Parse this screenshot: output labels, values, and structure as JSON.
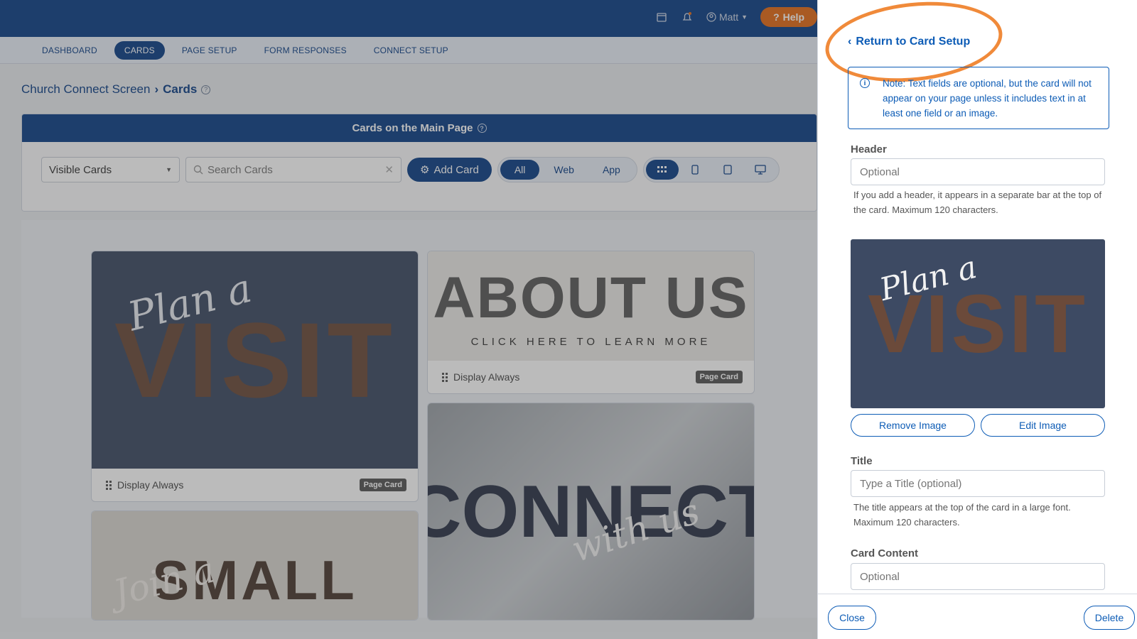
{
  "topbar": {
    "user_name": "Matt",
    "help_label": "Help"
  },
  "nav": {
    "items": [
      "DASHBOARD",
      "CARDS",
      "PAGE SETUP",
      "FORM RESPONSES",
      "CONNECT SETUP"
    ],
    "active": "CARDS"
  },
  "breadcrumb": {
    "parent": "Church Connect Screen",
    "current": "Cards"
  },
  "panel": {
    "title": "Cards on the Main Page",
    "filter_select": "Visible Cards",
    "search_placeholder": "Search Cards",
    "add_card_label": "Add Card",
    "platform_tabs": [
      "All",
      "Web",
      "App"
    ],
    "active_platform": "All"
  },
  "cards": [
    {
      "image_script": "Plan a",
      "image_text": "VISIT",
      "display": "Display Always",
      "badge": "Page Card"
    },
    {
      "image_text": "ABOUT US",
      "image_sub": "CLICK HERE TO LEARN MORE",
      "display": "Display Always",
      "badge": "Page Card"
    },
    {
      "image_script": "with us",
      "image_text": "CONNECT"
    },
    {
      "image_script": "Join a",
      "image_text": "SMALL"
    }
  ],
  "drawer": {
    "return_label": "Return to Card Setup",
    "note": "Note: Text fields are optional, but the card will not appear on your page unless it includes text in at least one field or an image.",
    "header_label": "Header",
    "header_placeholder": "Optional",
    "header_help": "If you add a header, it appears in a separate bar at the top of the card. Maximum 120 characters.",
    "preview_script": "Plan a",
    "preview_text": "VISIT",
    "remove_image_label": "Remove Image",
    "edit_image_label": "Edit Image",
    "title_label": "Title",
    "title_placeholder": "Type a Title (optional)",
    "title_help": "The title appears at the top of the card in a large font. Maximum 120 characters.",
    "content_label": "Card Content",
    "content_placeholder": "Optional",
    "close_label": "Close",
    "delete_label": "Delete"
  },
  "colors": {
    "primary": "#0d3f86",
    "link": "#0d5cb6",
    "help_orange": "#e36a16",
    "highlight_ring": "#f08a3a",
    "card_bg": "#3d4a63"
  }
}
